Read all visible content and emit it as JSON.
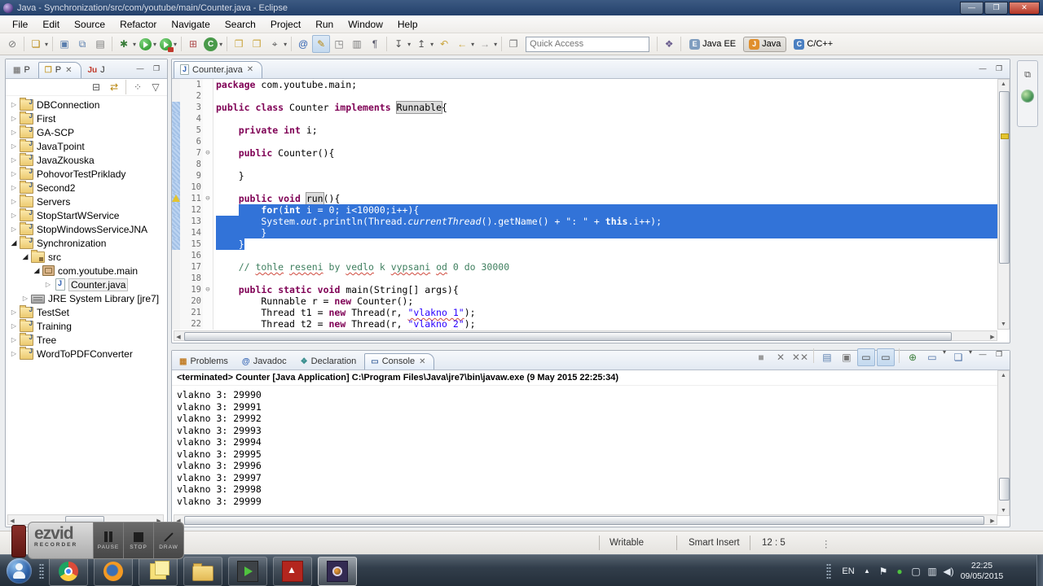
{
  "window": {
    "title": "Java - Synchronization/src/com/youtube/main/Counter.java - Eclipse",
    "controls": [
      {
        "n": "minimize-button",
        "g": "—"
      },
      {
        "n": "maximize-button",
        "g": "❐"
      },
      {
        "n": "close-button",
        "g": "✕",
        "close": true
      }
    ]
  },
  "menubar": {
    "items": [
      "File",
      "Edit",
      "Source",
      "Refactor",
      "Navigate",
      "Search",
      "Project",
      "Run",
      "Window",
      "Help"
    ]
  },
  "toolbar": {
    "quick_access_placeholder": "Quick Access",
    "items": [
      {
        "n": "skip-all-breakpoints",
        "g": "⊘",
        "c": "#777"
      },
      {
        "sep": true
      },
      {
        "n": "new-wizard",
        "g": "❏",
        "c": "#b8860b",
        "dd": true
      },
      {
        "sep": true
      },
      {
        "n": "save",
        "g": "▣",
        "c": "#5b7fae"
      },
      {
        "n": "save-all",
        "g": "⧉",
        "c": "#5b7fae"
      },
      {
        "n": "print",
        "g": "▤",
        "c": "#777"
      },
      {
        "sep": true
      },
      {
        "n": "debug",
        "g": "✱",
        "c": "#3a7d3a",
        "dd": true
      },
      {
        "n": "run",
        "run": true,
        "dd": true
      },
      {
        "n": "run-external-tools",
        "run": true,
        "runx": true,
        "dd": true
      },
      {
        "sep": true
      },
      {
        "n": "coverage",
        "g": "⊞",
        "c": "#b05050"
      },
      {
        "n": "new-java-class",
        "g": "C",
        "bg": "#4a9a4a",
        "dd": true
      },
      {
        "sep": true
      },
      {
        "n": "open-element",
        "g": "❒",
        "c": "#caa53d"
      },
      {
        "n": "open-resource",
        "g": "❒",
        "c": "#caa53d"
      },
      {
        "n": "search",
        "g": "⌖",
        "c": "#555",
        "dd": true
      },
      {
        "sep": true
      },
      {
        "n": "external-javadoc",
        "g": "@",
        "c": "#2a5db0"
      },
      {
        "n": "mark-occurrences",
        "g": "✎",
        "c": "#b8860b",
        "pressed": true
      },
      {
        "n": "open-type-hierarchy",
        "g": "◳",
        "c": "#777"
      },
      {
        "n": "show-clipboard",
        "g": "▥",
        "c": "#777"
      },
      {
        "n": "show-whitespace",
        "g": "¶",
        "c": "#556"
      },
      {
        "sep": true
      },
      {
        "n": "next-annotation",
        "g": "↧",
        "c": "#555",
        "dd": true
      },
      {
        "n": "previous-annotation",
        "g": "↥",
        "c": "#555",
        "dd": true
      },
      {
        "n": "last-edit-location",
        "g": "↶",
        "c": "#caa53d"
      },
      {
        "n": "back",
        "g": "←",
        "c": "#caa53d",
        "dd": true
      },
      {
        "n": "forward",
        "g": "→",
        "c": "#9a9a9a",
        "dd": true
      },
      {
        "sep": true
      },
      {
        "n": "pin-editor",
        "g": "❐",
        "c": "#777"
      }
    ],
    "open_perspective_icon": "❖",
    "perspectives": [
      {
        "n": "perspective-java-ee",
        "label": "Java EE",
        "g": "E",
        "bg": "#7f9dbf"
      },
      {
        "n": "perspective-java",
        "label": "Java",
        "g": "J",
        "bg": "#e08f2d",
        "active": true
      },
      {
        "n": "perspective-c-cpp",
        "label": "C/C++",
        "g": "C",
        "bg": "#4a7fc1"
      }
    ]
  },
  "explorer": {
    "tabs": [
      {
        "n": "tab-project-explorer",
        "label": "P",
        "icon": "▦",
        "ic": "#888"
      },
      {
        "n": "tab-package-explorer",
        "label": "P",
        "icon": "❒",
        "ic": "#c9a23f",
        "active": true,
        "close": "✕"
      },
      {
        "n": "tab-junit",
        "label": "J",
        "icon": "Ju",
        "ic": "#c0392b"
      }
    ],
    "toolbar": [
      {
        "n": "collapse-all",
        "g": "⊟",
        "c": "#555"
      },
      {
        "n": "link-with-editor",
        "g": "⇄",
        "c": "#b8860b"
      },
      {
        "sep": true
      },
      {
        "n": "view-menu-dots",
        "g": "⁘",
        "c": "#555"
      },
      {
        "n": "view-menu",
        "g": "▽",
        "c": "#555"
      }
    ],
    "minimize_glyph": "—",
    "maximize_glyph": "❐",
    "tree": [
      {
        "label": "DBConnection",
        "level": 0,
        "arrow": "c",
        "icon": "jproj"
      },
      {
        "label": "First",
        "level": 0,
        "arrow": "c",
        "icon": "jproj"
      },
      {
        "label": "GA-SCP",
        "level": 0,
        "arrow": "c",
        "icon": "jproj"
      },
      {
        "label": "JavaTpoint",
        "level": 0,
        "arrow": "c",
        "icon": "jproj"
      },
      {
        "label": "JavaZkouska",
        "level": 0,
        "arrow": "c",
        "icon": "jproj"
      },
      {
        "label": "PohovorTestPriklady",
        "level": 0,
        "arrow": "c",
        "icon": "jproj"
      },
      {
        "label": "Second2",
        "level": 0,
        "arrow": "c",
        "icon": "jproj"
      },
      {
        "label": "Servers",
        "level": 0,
        "arrow": "c",
        "icon": "folder"
      },
      {
        "label": "StopStartWService",
        "level": 0,
        "arrow": "c",
        "icon": "jproj"
      },
      {
        "label": "StopWindowsServiceJNA",
        "level": 0,
        "arrow": "c",
        "icon": "jproj"
      },
      {
        "label": "Synchronization",
        "level": 0,
        "arrow": "e",
        "icon": "jproj"
      },
      {
        "label": "src",
        "level": 1,
        "arrow": "e",
        "icon": "src"
      },
      {
        "label": "com.youtube.main",
        "level": 2,
        "arrow": "e",
        "icon": "pkg"
      },
      {
        "label": "Counter.java",
        "level": 3,
        "arrow": "c",
        "icon": "jfile",
        "selected": true
      },
      {
        "label": "JRE System Library [jre7]",
        "level": 1,
        "arrow": "c",
        "icon": "lib"
      },
      {
        "label": "TestSet",
        "level": 0,
        "arrow": "c",
        "icon": "jproj"
      },
      {
        "label": "Training",
        "level": 0,
        "arrow": "c",
        "icon": "jproj"
      },
      {
        "label": "Tree",
        "level": 0,
        "arrow": "c",
        "icon": "jproj"
      },
      {
        "label": "WordToPDFConverter",
        "level": 0,
        "arrow": "c",
        "icon": "jproj"
      }
    ]
  },
  "editor": {
    "tab": {
      "label": "Counter.java",
      "close": "✕"
    },
    "fold_glyph": "⊖",
    "lines": [
      {
        "n": "1",
        "segs": [
          [
            "package",
            "k"
          ],
          [
            " com.youtube.main;",
            "p"
          ]
        ]
      },
      {
        "n": "2",
        "segs": []
      },
      {
        "n": "3",
        "diff": true,
        "segs": [
          [
            "public",
            "k"
          ],
          [
            " ",
            "p"
          ],
          [
            "class",
            "k"
          ],
          [
            " Counter ",
            "p"
          ],
          [
            "implements",
            "k"
          ],
          [
            " ",
            "p"
          ],
          [
            "Runnable",
            "o"
          ],
          [
            "{",
            "p"
          ]
        ]
      },
      {
        "n": "4",
        "diff": true,
        "segs": []
      },
      {
        "n": "5",
        "diff": true,
        "segs": [
          [
            "    ",
            "p"
          ],
          [
            "private",
            "k"
          ],
          [
            " ",
            "p"
          ],
          [
            "int",
            "k"
          ],
          [
            " i;",
            "p"
          ]
        ]
      },
      {
        "n": "6",
        "diff": true,
        "segs": []
      },
      {
        "n": "7",
        "diff": true,
        "fold": true,
        "segs": [
          [
            "    ",
            "p"
          ],
          [
            "public",
            "k"
          ],
          [
            " Counter(){",
            "p"
          ]
        ]
      },
      {
        "n": "8",
        "diff": true,
        "segs": []
      },
      {
        "n": "9",
        "diff": true,
        "segs": [
          [
            "    }",
            "p"
          ]
        ]
      },
      {
        "n": "10",
        "diff": true,
        "segs": []
      },
      {
        "n": "11",
        "diff": true,
        "fold": true,
        "warn": true,
        "segs": [
          [
            "    ",
            "p"
          ],
          [
            "public",
            "k"
          ],
          [
            " ",
            "p"
          ],
          [
            "void",
            "k"
          ],
          [
            " ",
            "p"
          ],
          [
            "run",
            "o"
          ],
          [
            "(){",
            "p"
          ]
        ]
      },
      {
        "n": "12",
        "diff": true,
        "sel": "full",
        "pre": "    ",
        "segs": [
          [
            "    ",
            "p"
          ],
          [
            "for",
            "k"
          ],
          [
            "(",
            "p"
          ],
          [
            "int",
            "k"
          ],
          [
            " i = 0; i<10000;i++){",
            "p"
          ]
        ]
      },
      {
        "n": "13",
        "diff": true,
        "sel": "full",
        "segs": [
          [
            "        System.",
            "p"
          ],
          [
            "out",
            "ib"
          ],
          [
            ".println(Thread.",
            "p"
          ],
          [
            "currentThread",
            "i2"
          ],
          [
            "().getName() + ",
            "p"
          ],
          [
            "\": \"",
            "s"
          ],
          [
            " + ",
            "p"
          ],
          [
            "this",
            "k"
          ],
          [
            ".i++);",
            "p"
          ]
        ]
      },
      {
        "n": "14",
        "diff": true,
        "sel": "full",
        "segs": [
          [
            "        }",
            "p"
          ]
        ]
      },
      {
        "n": "15",
        "diff": true,
        "sel": "end",
        "segs": [
          [
            "    }",
            "p"
          ]
        ]
      },
      {
        "n": "16",
        "segs": []
      },
      {
        "n": "17",
        "segs": [
          [
            "    ",
            "p"
          ],
          [
            "// ",
            "c"
          ],
          [
            "tohle",
            "cw"
          ],
          [
            " ",
            "c"
          ],
          [
            "reseni",
            "cw"
          ],
          [
            " by ",
            "c"
          ],
          [
            "vedlo",
            "cw"
          ],
          [
            " k ",
            "c"
          ],
          [
            "vypsani",
            "cw"
          ],
          [
            " ",
            "c"
          ],
          [
            "od",
            "cw"
          ],
          [
            " 0 do 30000",
            "c"
          ]
        ]
      },
      {
        "n": "18",
        "segs": []
      },
      {
        "n": "19",
        "fold": true,
        "segs": [
          [
            "    ",
            "p"
          ],
          [
            "public",
            "k"
          ],
          [
            " ",
            "p"
          ],
          [
            "static",
            "k"
          ],
          [
            " ",
            "p"
          ],
          [
            "void",
            "k"
          ],
          [
            " main(String[] args){",
            "p"
          ]
        ]
      },
      {
        "n": "20",
        "segs": [
          [
            "        Runnable r = ",
            "p"
          ],
          [
            "new",
            "k"
          ],
          [
            " Counter();",
            "p"
          ]
        ]
      },
      {
        "n": "21",
        "segs": [
          [
            "        Thread t1 = ",
            "p"
          ],
          [
            "new",
            "k"
          ],
          [
            " Thread(r, ",
            "p"
          ],
          [
            "\"vlakno 1\"",
            "sw"
          ],
          [
            ");",
            "p"
          ]
        ]
      },
      {
        "n": "22",
        "segs": [
          [
            "        Thread t2 = ",
            "p"
          ],
          [
            "new",
            "k"
          ],
          [
            " Thread(r, ",
            "p"
          ],
          [
            "\"vlakno 2\"",
            "sw"
          ],
          [
            ");",
            "p"
          ]
        ]
      }
    ]
  },
  "console": {
    "tabs": [
      {
        "n": "tab-problems",
        "label": "Problems",
        "icon": "▦",
        "ic": "#c27f2a"
      },
      {
        "n": "tab-javadoc",
        "label": "Javadoc",
        "icon": "@",
        "ic": "#2a5db0"
      },
      {
        "n": "tab-declaration",
        "label": "Declaration",
        "icon": "❖",
        "ic": "#3a8f8f"
      },
      {
        "n": "tab-console",
        "label": "Console",
        "icon": "▭",
        "ic": "#4a6fa5",
        "active": true,
        "close": "✕"
      }
    ],
    "toolbar": [
      {
        "n": "terminate",
        "g": "■",
        "c": "#9a9a9a"
      },
      {
        "n": "remove-launch",
        "g": "✕",
        "c": "#777"
      },
      {
        "n": "remove-all-terminated",
        "g": "✕✕",
        "c": "#777"
      },
      {
        "sep": true
      },
      {
        "n": "clear-console",
        "g": "▤",
        "c": "#5b7fae"
      },
      {
        "n": "scroll-lock",
        "g": "▣",
        "c": "#777"
      },
      {
        "n": "show-stdout-change",
        "g": "▭",
        "c": "#444",
        "pressed": true
      },
      {
        "n": "show-stderr-change",
        "g": "▭",
        "c": "#444",
        "pressed": true
      },
      {
        "sep": true
      },
      {
        "n": "pin-console",
        "g": "⊕",
        "c": "#3a7d3a"
      },
      {
        "n": "display-selected-console",
        "g": "▭",
        "c": "#4a6fa5",
        "dd": true
      },
      {
        "n": "open-console",
        "g": "❏",
        "c": "#4a6fa5",
        "dd": true
      }
    ],
    "minimize_glyph": "—",
    "maximize_glyph": "❐",
    "header": "<terminated> Counter [Java Application] C:\\Program Files\\Java\\jre7\\bin\\javaw.exe (9 May 2015 22:25:34)",
    "lines": [
      "vlakno 3: 29990",
      "vlakno 3: 29991",
      "vlakno 3: 29992",
      "vlakno 3: 29993",
      "vlakno 3: 29994",
      "vlakno 3: 29995",
      "vlakno 3: 29996",
      "vlakno 3: 29997",
      "vlakno 3: 29998",
      "vlakno 3: 29999"
    ]
  },
  "statusbar": {
    "writable": "Writable",
    "insert_mode": "Smart Insert",
    "caret_position": "12 : 5",
    "overflow_glyph": "⋮"
  },
  "ezvid": {
    "brand": "ezvid",
    "sub": "RECORDER",
    "buttons": [
      {
        "n": "pause-button",
        "label": "PAUSE",
        "glyph": "pause"
      },
      {
        "n": "stop-button",
        "label": "STOP",
        "glyph": "stop"
      },
      {
        "n": "draw-button",
        "label": "DRAW",
        "glyph": "draw"
      }
    ]
  },
  "fastview": {
    "items": [
      {
        "n": "restore-view-button",
        "g": "⧉"
      },
      {
        "n": "minimized-outline-view",
        "globe": true
      }
    ]
  },
  "taskbar": {
    "apps": [
      {
        "n": "taskbar-chrome",
        "icon": "chrome"
      },
      {
        "n": "taskbar-firefox",
        "icon": "firefox"
      },
      {
        "n": "taskbar-sticky-notes",
        "icon": "notes"
      },
      {
        "n": "taskbar-explorer",
        "icon": "explorer"
      },
      {
        "n": "taskbar-media-app",
        "icon": "media"
      },
      {
        "n": "taskbar-adobe-reader",
        "icon": "adobe"
      },
      {
        "n": "taskbar-eclipse",
        "icon": "eclipse",
        "active": true
      }
    ],
    "tray": {
      "language": "EN",
      "hidden_icons_glyph": "▲",
      "icons": [
        {
          "n": "action-center-icon",
          "g": "⚑",
          "c": "#e8edf2"
        },
        {
          "n": "antivirus-icon",
          "g": "●",
          "c": "#4fc33f"
        },
        {
          "n": "network-icon",
          "g": "▢",
          "c": "#dfe6ee"
        },
        {
          "n": "installer-icon",
          "g": "▥",
          "c": "#dfe6ee"
        },
        {
          "n": "volume-icon",
          "g": "◀)",
          "c": "#dfe6ee"
        }
      ],
      "time": "22:25",
      "date": "09/05/2015"
    }
  }
}
